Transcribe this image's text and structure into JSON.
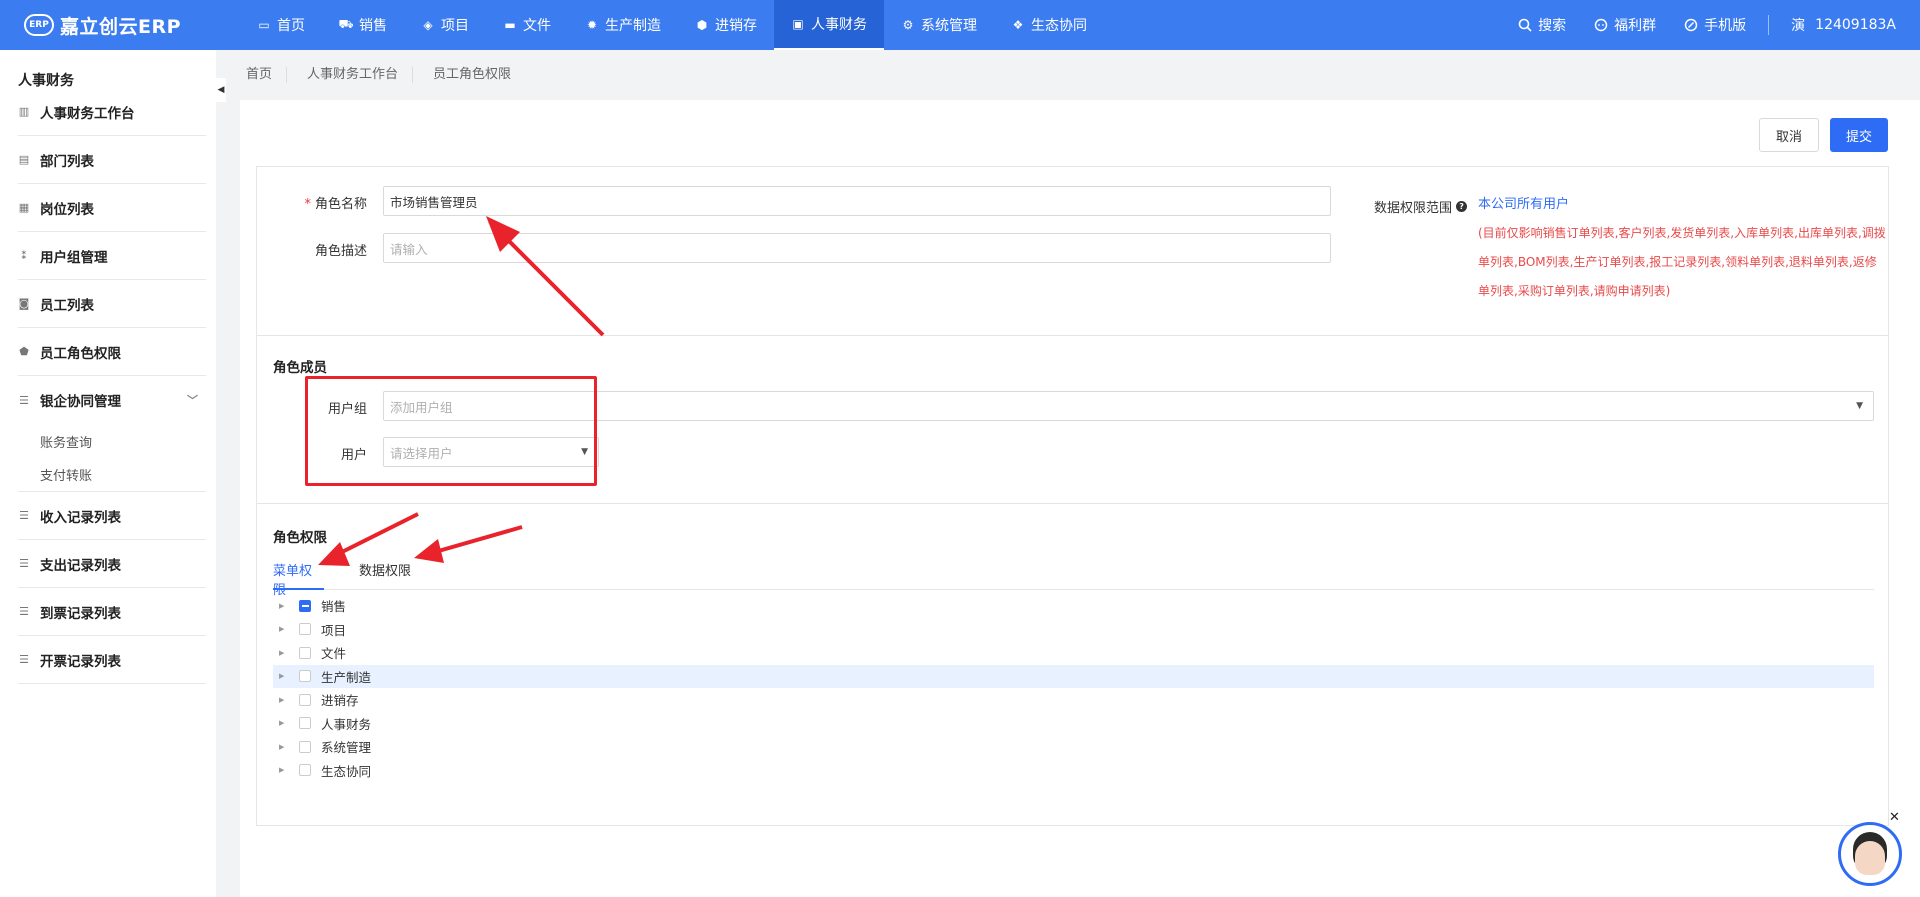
{
  "app": {
    "logo_mark": "ERP",
    "logo_text": "嘉立创云ERP"
  },
  "nav": [
    {
      "label": "首页",
      "icon": "monitor-icon"
    },
    {
      "label": "销售",
      "icon": "cart-icon"
    },
    {
      "label": "项目",
      "icon": "layers-icon"
    },
    {
      "label": "文件",
      "icon": "folder-icon"
    },
    {
      "label": "生产制造",
      "icon": "gear-icon"
    },
    {
      "label": "进销存",
      "icon": "box-icon"
    },
    {
      "label": "人事财务",
      "icon": "id-card-icon",
      "active": true
    },
    {
      "label": "系统管理",
      "icon": "settings-icon"
    },
    {
      "label": "生态协同",
      "icon": "cluster-icon"
    }
  ],
  "topright": {
    "search": "搜索",
    "group": "福利群",
    "mobile": "手机版",
    "user_avatar": "演",
    "user_name": "12409183A"
  },
  "sidebar": {
    "title": "人事财务",
    "items": [
      {
        "label": "人事财务工作台",
        "icon": "chart-icon"
      },
      {
        "label": "部门列表",
        "icon": "document-icon"
      },
      {
        "label": "岗位列表",
        "icon": "id-card-icon"
      },
      {
        "label": "用户组管理",
        "icon": "usergroup-icon"
      },
      {
        "label": "员工列表",
        "icon": "person-icon"
      },
      {
        "label": "员工角色权限",
        "icon": "shield-icon"
      },
      {
        "label": "银企协同管理",
        "icon": "list-icon"
      },
      {
        "label": "收入记录列表",
        "icon": "list-icon"
      },
      {
        "label": "支出记录列表",
        "icon": "list-icon"
      },
      {
        "label": "到票记录列表",
        "icon": "list-icon"
      },
      {
        "label": "开票记录列表",
        "icon": "list-icon"
      }
    ],
    "subitems": [
      "账务查询",
      "支付转账"
    ]
  },
  "breadcrumb": [
    "首页",
    "人事财务工作台",
    "员工角色权限"
  ],
  "actions": {
    "cancel": "取消",
    "submit": "提交"
  },
  "form": {
    "role_name_label": "角色名称",
    "role_name_value": "市场销售管理员",
    "role_desc_label": "角色描述",
    "role_desc_placeholder": "请输入",
    "scope_label": "数据权限范围",
    "scope_value": "本公司所有用户",
    "scope_note": "(目前仅影响销售订单列表,客户列表,发货单列表,入库单列表,出库单列表,调拨单列表,BOM列表,生产订单列表,报工记录列表,领料单列表,退料单列表,返修单列表,采购订单列表,请购申请列表)"
  },
  "members": {
    "title": "角色成员",
    "usergroup_label": "用户组",
    "usergroup_placeholder": "添加用户组",
    "user_label": "用户",
    "user_placeholder": "请选择用户"
  },
  "permissions": {
    "title": "角色权限",
    "tabs": [
      "菜单权限",
      "数据权限"
    ],
    "tree": [
      {
        "label": "销售",
        "state": "partial"
      },
      {
        "label": "项目",
        "state": "unchecked"
      },
      {
        "label": "文件",
        "state": "unchecked"
      },
      {
        "label": "生产制造",
        "state": "unchecked",
        "highlight": true
      },
      {
        "label": "进销存",
        "state": "unchecked"
      },
      {
        "label": "人事财务",
        "state": "unchecked"
      },
      {
        "label": "系统管理",
        "state": "unchecked"
      },
      {
        "label": "生态协同",
        "state": "unchecked"
      }
    ]
  },
  "colors": {
    "primary": "#3b7cf0",
    "annotation": "#e8232b",
    "note": "#e84a4a"
  }
}
